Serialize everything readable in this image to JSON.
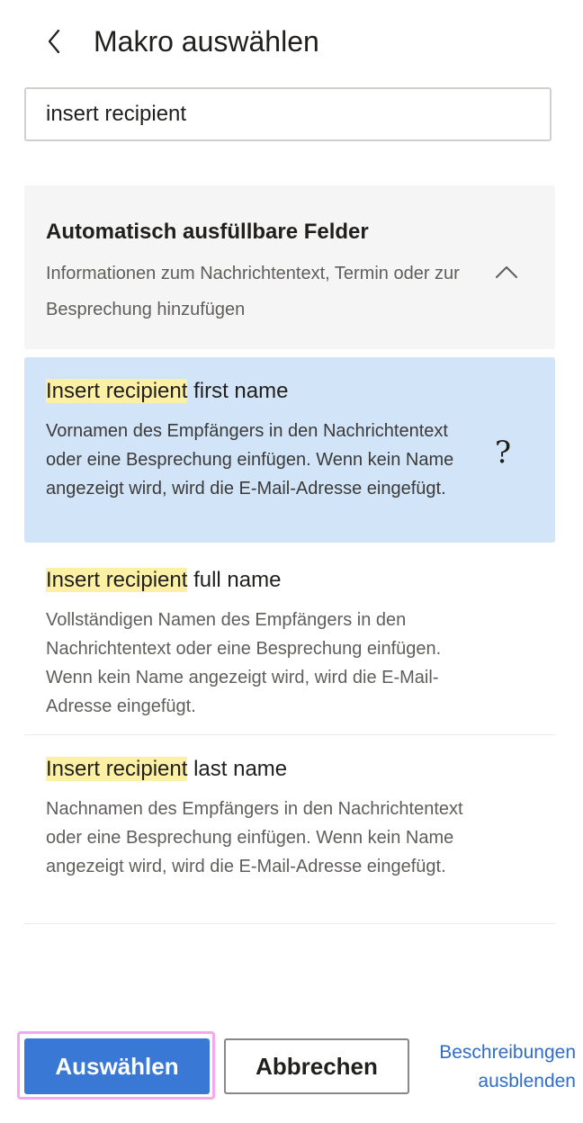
{
  "header": {
    "title": "Makro auswählen",
    "back_icon": "chevron-left-icon"
  },
  "search": {
    "value": "insert recipient",
    "placeholder": ""
  },
  "category": {
    "title": "Automatisch ausfüllbare Felder",
    "description": "Informationen zum Nachrichtentext, Termin oder zur Besprechung hinzufügen",
    "toggle_icon": "chevron-up-icon",
    "expanded": true
  },
  "items": [
    {
      "highlight": "Insert recipient",
      "rest": " first name",
      "description": "Vornamen des Empfängers in den Nachrichtentext oder eine Besprechung einfügen. Wenn kein Name angezeigt wird, wird die E-Mail-Adresse eingefügt.",
      "selected": true,
      "help_icon": "?"
    },
    {
      "highlight": "Insert recipient",
      "rest": " full name",
      "description": "Vollständigen Namen des Empfängers in den Nachrichtentext oder eine Besprechung einfügen. Wenn kein Name angezeigt wird, wird die E-Mail-Adresse eingefügt.",
      "selected": false
    },
    {
      "highlight": "Insert recipient",
      "rest": " last name",
      "description": "Nachnamen des Empfängers in den Nachrichtentext oder eine Besprechung einfügen. Wenn kein Name angezeigt wird, wird die E-Mail-Adresse eingefügt.",
      "selected": false
    }
  ],
  "footer": {
    "select_label": "Auswählen",
    "cancel_label": "Abbrechen",
    "toggle_descriptions_label": "Beschreibungen ausblenden"
  },
  "colors": {
    "primary": "#3a78d6",
    "selected_bg": "#d2e4f7",
    "highlight": "#fbf0a4",
    "link": "#2f6dc8",
    "focus_ring": "#f6a7f0"
  }
}
